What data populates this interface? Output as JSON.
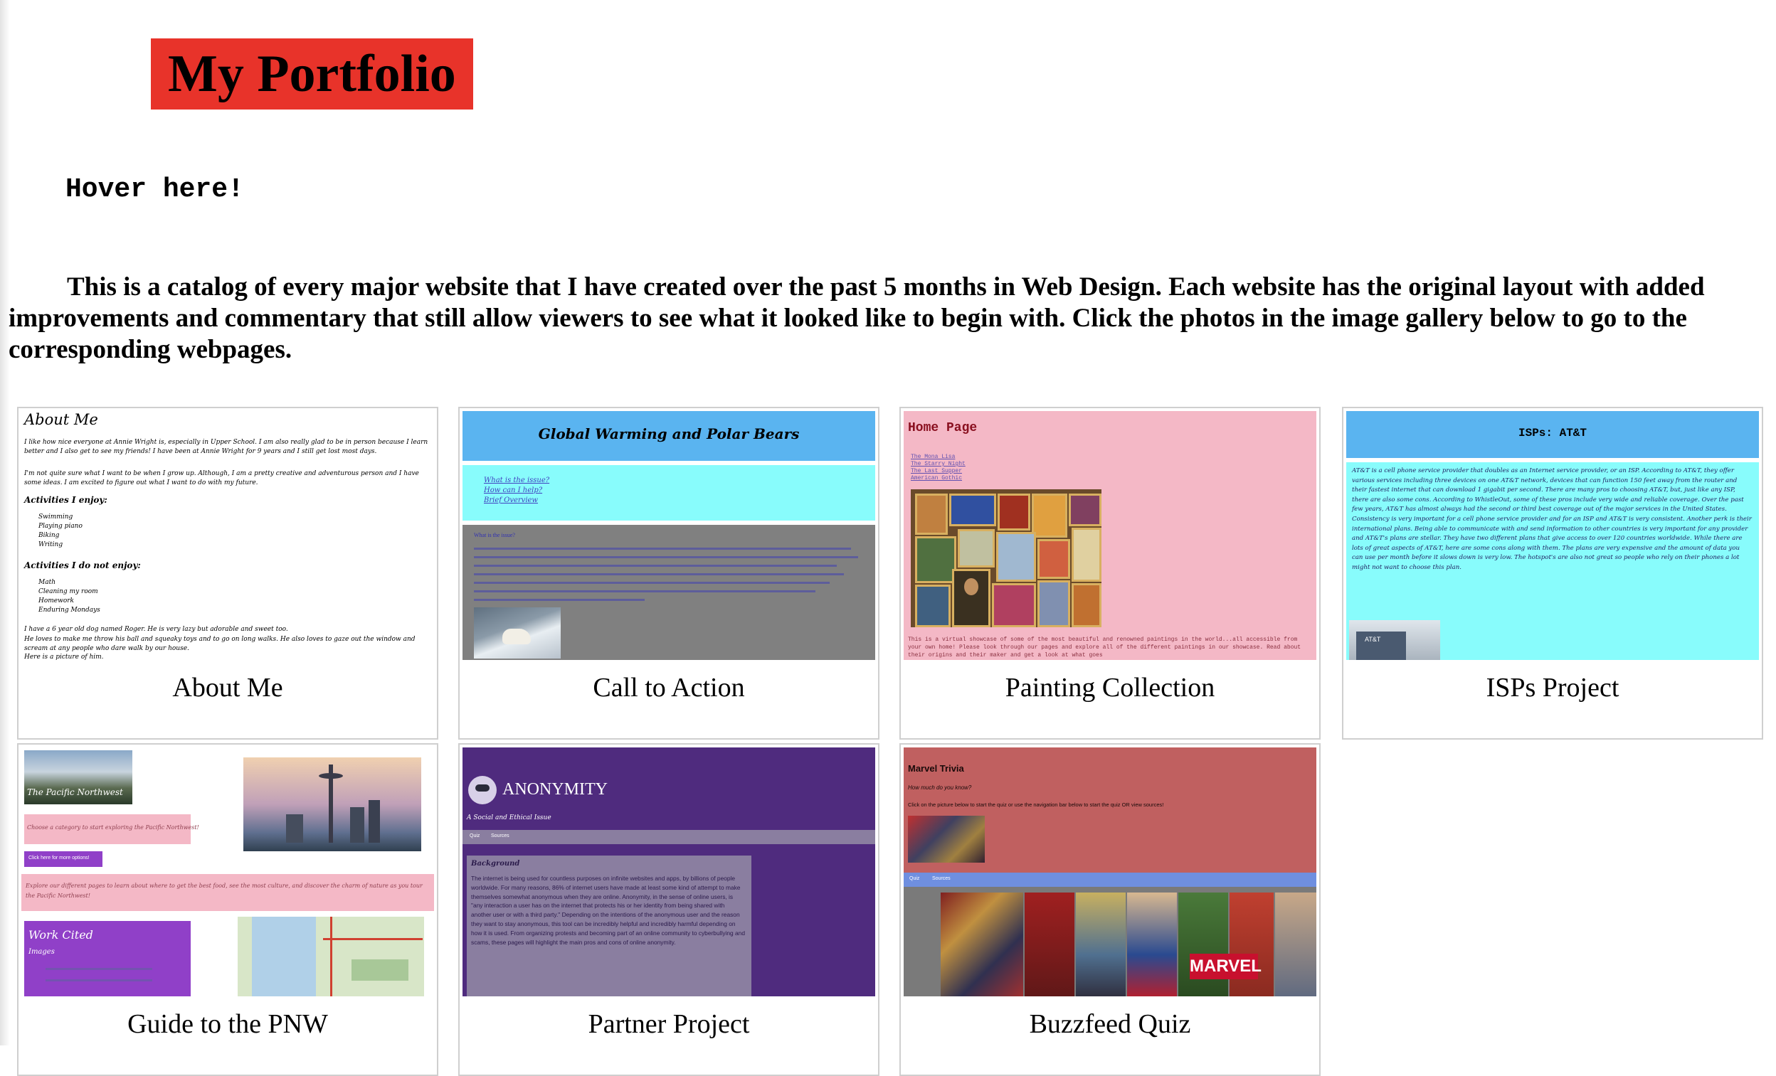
{
  "header": {
    "title": "My Portfolio",
    "hover_prompt": "Hover here!",
    "intro": "This is a catalog of every major website that I have created over the past 5 months in Web Design. Each website has the original layout with added improvements and commentary that still allow viewers to see what it looked like to begin with. Click the photos in the image gallery below to go to the corresponding webpages."
  },
  "gallery": [
    {
      "caption": "About Me",
      "thumb": {
        "heading": "About Me",
        "intro": "I like how nice everyone at Annie Wright is, especially in Upper School. I am also really glad to be in person because I learn better and I also get to see my friends! I have been at Annie Wright for 9 years and I still get lost most days.",
        "intro2": "I'm not quite sure what I want to be when I grow up. Although, I am a pretty creative and adventurous person and I have some ideas. I am excited to figure out what I want to do with my future.",
        "enjoy_heading": "Activities I enjoy:",
        "enjoy": [
          "Swimming",
          "Playing piano",
          "Biking",
          "Writing"
        ],
        "not_enjoy_heading": "Activities I do not enjoy:",
        "not_enjoy": [
          "Math",
          "Cleaning my room",
          "Homework",
          "Enduring Mondays"
        ],
        "dog": "I have a 6 year old dog named Roger. He is very lazy but adorable and sweet too.",
        "dog2": "He loves to make me throw his ball and squeaky toys and to go on long walks. He also loves to gaze out the window and scream at any people who dare walk by our house.",
        "dog3": "Here is a picture of him."
      }
    },
    {
      "caption": "Call to Action",
      "thumb": {
        "heading": "Global Warming and Polar Bears",
        "links": [
          "What is the issue?",
          "How can I help?",
          "Brief Overview"
        ],
        "section": "What is the issue?"
      }
    },
    {
      "caption": "Painting Collection",
      "thumb": {
        "heading": "Home Page",
        "links": [
          "The Mona Lisa",
          "The Starry Night",
          "The Last Supper",
          "American Gothic"
        ],
        "blurb": "This is a virtual showcase of some of the most beautiful and renowned paintings in the world...all accessible from your own home! Please look through our pages and explore all of the different paintings in our showcase. Read about their origins and their maker and get a look at what goes"
      }
    },
    {
      "caption": "ISPs Project",
      "thumb": {
        "heading": "ISPs: AT&T",
        "body": "AT&T is a cell phone service provider that doubles as an Internet service provider, or an ISP. According to AT&T, they offer various services including three devices on one AT&T network, devices that can function 150 feet away from the router and their fastest internet that can download 1 gigabit per second. There are many pros to choosing AT&T, but, just like any ISP, there are also some cons. According to WhistleOut, some of these pros include very wide and reliable coverage. Over the past few years, AT&T has almost always had the second or third best coverage out of the major services in the United States. Consistency is very important for a cell phone service provider and for an ISP and AT&T is very consistent. Another perk is their international plans. Being able to communicate with and send information to other countries is very important for any provider and AT&T's plans are stellar. They have two different plans that give access to over 120 countries worldwide. While there are lots of great aspects of AT&T, here are some cons along with them. The plans are very expensive and the amount of data you can use per month before it slows down is very low. The hotspot's are also not great so people who rely on their phones a lot might not want to choose this plan.",
        "logo": "AT&T"
      }
    },
    {
      "caption": "Guide to the PNW",
      "thumb": {
        "logo": "The Pacific Northwest",
        "category": "Choose a category to start exploring the Pacific Northwest!",
        "button": "Click here for more options!",
        "explore": "Explore our different pages to learn about where to get the best food, see the most culture, and discover the charm of nature as you tour the Pacific Northwest!",
        "work_cited": "Work Cited",
        "images": "Images"
      }
    },
    {
      "caption": "Partner Project",
      "thumb": {
        "heading": "ANONYMITY",
        "subtitle": "A Social and Ethical Issue",
        "nav": [
          "Quiz",
          "Sources"
        ],
        "section": "Background",
        "body": "The internet is being used for countless purposes on infinite websites and apps, by billions of people worldwide. For many reasons, 86% of internet users have made at least some kind of attempt to make themselves somewhat anonymous when they are online. Anonymity, in the sense of online users, is \"any interaction a user has on the internet that protects his or her identity from being shared with another user or with a third party.\" Depending on the intentions of the anonymous user and the reason they want to stay anonymous, this tool can be incredibly helpful and incredibly harmful depending on how it is used. From organizing protests and becoming part of an online community to cyberbullying and scams, these pages will highlight the main pros and cons of online anonymity."
      }
    },
    {
      "caption": "Buzzfeed Quiz",
      "thumb": {
        "heading": "Marvel Trivia",
        "question": "How much do you know?",
        "instructions": "Click on the picture below to start the quiz or use the navigation bar below to start the quiz OR view sources!",
        "nav": [
          "Quiz",
          "Sources"
        ],
        "logo": "MARVEL"
      }
    }
  ],
  "colors": {
    "title_bg": "#e8332a",
    "cta_blue": "#5ab4f0",
    "cta_cyan": "#88fcfc",
    "painting_pink": "#f4b8c6",
    "partner_purple": "#4f2b7e",
    "quiz_red": "#c06060",
    "quiz_nav": "#6f8fe0"
  }
}
